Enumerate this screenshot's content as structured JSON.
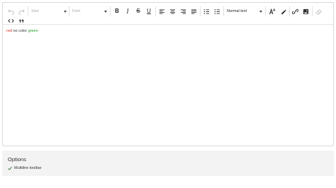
{
  "toolbar": {
    "size_placeholder": "Size",
    "font_placeholder": "Font",
    "bold_label": "B",
    "italic_label": "I",
    "strike_label": "S",
    "underline_label": "U",
    "block_type": "Normal text",
    "icons": [
      "undo-icon",
      "redo-icon",
      "align-left-icon",
      "align-center-icon",
      "align-right-icon",
      "align-justify-icon",
      "ordered-list-icon",
      "unordered-list-icon",
      "text-color-icon",
      "highlight-pen-icon",
      "link-icon",
      "image-icon",
      "clear-format-icon",
      "code-icon",
      "quote-icon"
    ]
  },
  "content": {
    "red_text": "red",
    "plain_text": " no color ",
    "green_text": "green"
  },
  "options": {
    "title": "Options",
    "multiline_label": "Multiline toolbar",
    "multiline_checked": true
  },
  "colors": {
    "red": "#d62b22",
    "green": "#1f9a1f",
    "panel_bg": "#f3f3f3",
    "border": "#d9d9d9"
  }
}
